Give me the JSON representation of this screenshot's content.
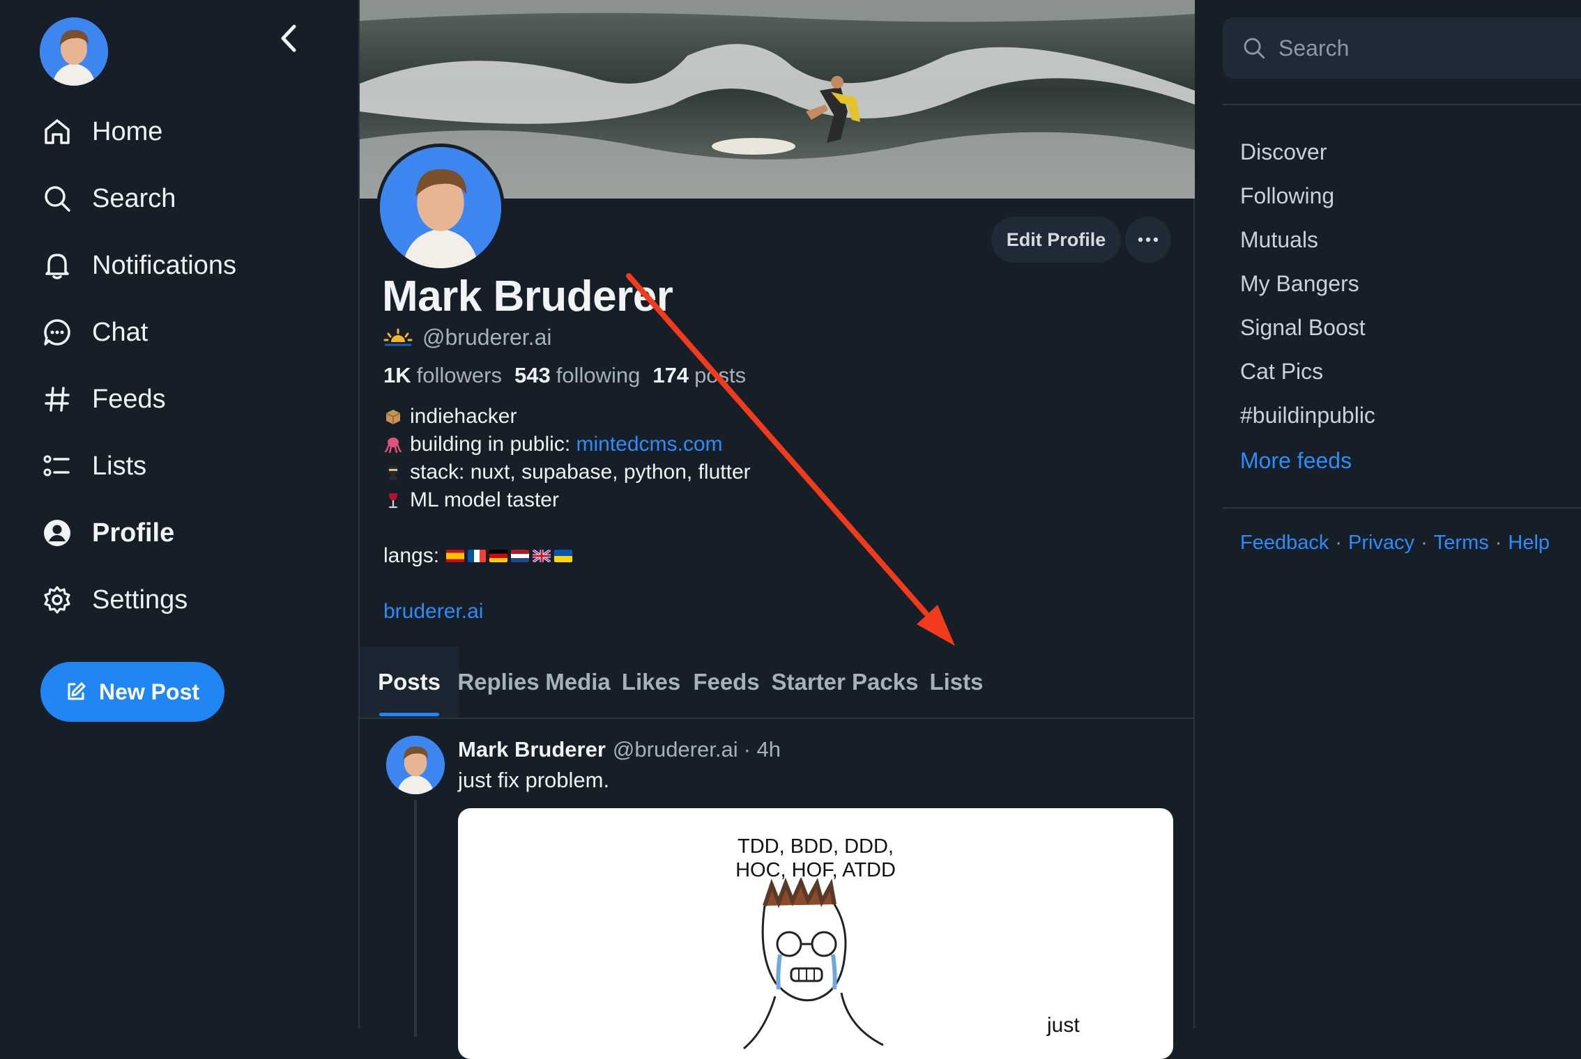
{
  "nav": {
    "back_label": "",
    "items": [
      {
        "label": "Home",
        "icon": "home-icon"
      },
      {
        "label": "Search",
        "icon": "search-icon"
      },
      {
        "label": "Notifications",
        "icon": "bell-icon"
      },
      {
        "label": "Chat",
        "icon": "chat-icon"
      },
      {
        "label": "Feeds",
        "icon": "hash-icon"
      },
      {
        "label": "Lists",
        "icon": "list-icon"
      },
      {
        "label": "Profile",
        "icon": "profile-icon",
        "active": true
      },
      {
        "label": "Settings",
        "icon": "gear-icon"
      }
    ],
    "new_post_label": "New Post"
  },
  "profile": {
    "display_name": "Mark Bruderer",
    "handle": "@bruderer.ai",
    "edit_label": "Edit Profile",
    "stats": {
      "followers_count": "1K",
      "followers_label": "followers",
      "following_count": "543",
      "following_label": "following",
      "posts_count": "174",
      "posts_label": "posts"
    },
    "bio": {
      "line1": "indiehacker",
      "line2_prefix": "building in public: ",
      "line2_link": "mintedcms.com",
      "line3": "stack: nuxt, supabase, python, flutter",
      "line4": "ML model taster",
      "langs_label": "langs:",
      "website": "bruderer.ai"
    }
  },
  "tabs": [
    "Posts",
    "Replies",
    "Media",
    "Likes",
    "Feeds",
    "Starter Packs",
    "Lists"
  ],
  "active_tab": "Posts",
  "post": {
    "author": "Mark Bruderer",
    "handle": "@bruderer.ai",
    "time": "· 4h",
    "text": "just fix problem.",
    "image_text_line1": "TDD, BDD, DDD,",
    "image_text_line2": "HOC, HOF, ATDD",
    "image_text_corner": "just"
  },
  "right": {
    "search_placeholder": "Search",
    "feeds": [
      "Discover",
      "Following",
      "Mutuals",
      "My Bangers",
      "Signal Boost",
      "Cat Pics",
      "#buildinpublic"
    ],
    "more_feeds": "More feeds",
    "footer": [
      "Feedback",
      "Privacy",
      "Terms",
      "Help"
    ]
  },
  "colors": {
    "background": "#161e27",
    "accent": "#1f86f3",
    "link": "#2d8cf7",
    "annotation_arrow": "#f23a1c"
  }
}
